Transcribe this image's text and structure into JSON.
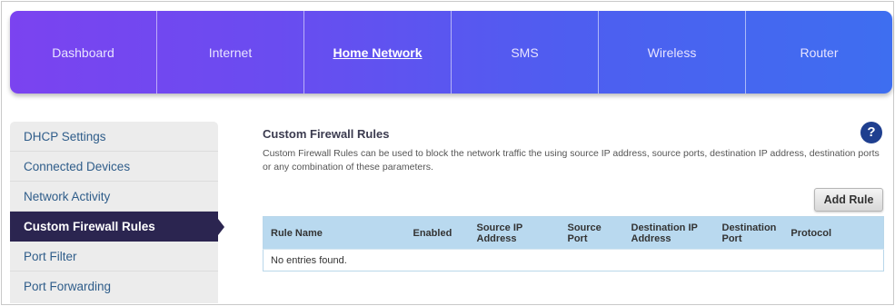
{
  "nav": {
    "items": [
      {
        "label": "Dashboard"
      },
      {
        "label": "Internet"
      },
      {
        "label": "Home Network"
      },
      {
        "label": "SMS"
      },
      {
        "label": "Wireless"
      },
      {
        "label": "Router"
      }
    ],
    "active": "Home Network"
  },
  "sidebar": {
    "items": [
      {
        "label": "DHCP Settings"
      },
      {
        "label": "Connected Devices"
      },
      {
        "label": "Network Activity"
      },
      {
        "label": "Custom Firewall Rules"
      },
      {
        "label": "Port Filter"
      },
      {
        "label": "Port Forwarding"
      }
    ],
    "active": "Custom Firewall Rules"
  },
  "main": {
    "title": "Custom Firewall Rules",
    "help": "?",
    "description": "Custom Firewall Rules can be used to block the network traffic the using source IP address, source ports, destination IP address, destination ports or any combination of these parameters.",
    "add_rule_label": "Add Rule",
    "table": {
      "columns": [
        "Rule Name",
        "Enabled",
        "Source IP Address",
        "Source Port",
        "Destination IP Address",
        "Destination Port",
        "Protocol"
      ],
      "empty_message": "No entries found."
    }
  },
  "colors": {
    "nav_gradient_start": "#7b43f0",
    "nav_gradient_end": "#3e6ef0",
    "sidebar_active": "#2b2550",
    "sidebar_link": "#2f5d8a",
    "table_header": "#b9d9ef",
    "help_icon": "#1f3f8f"
  },
  "icons": {
    "help": "help-icon",
    "active_pointer": "arrow-right-icon"
  }
}
